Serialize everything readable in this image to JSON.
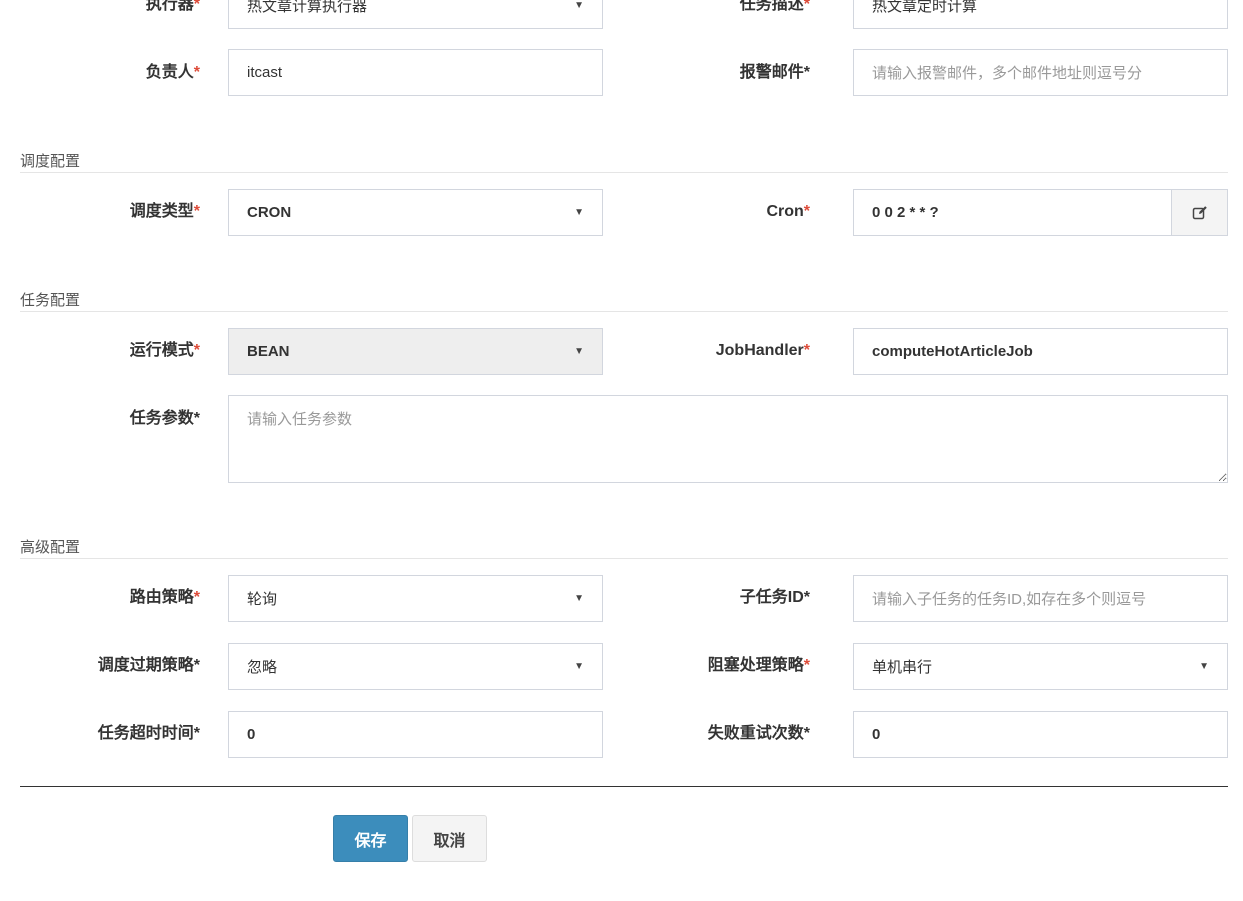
{
  "basic": {
    "executor_label": "执行器",
    "executor_value": "热文章计算执行器",
    "desc_label": "任务描述",
    "desc_value": "热文章定时计算",
    "author_label": "负责人",
    "author_value": "itcast",
    "alarm_label": "报警邮件",
    "alarm_placeholder": "请输入报警邮件，多个邮件地址则逗号分"
  },
  "schedule": {
    "section_title": "调度配置",
    "type_label": "调度类型",
    "type_value": "CRON",
    "cron_label": "Cron",
    "cron_value": "0 0 2 * * ?"
  },
  "task": {
    "section_title": "任务配置",
    "glue_label": "运行模式",
    "glue_value": "BEAN",
    "handler_label": "JobHandler",
    "handler_value": "computeHotArticleJob",
    "param_label": "任务参数",
    "param_placeholder": "请输入任务参数"
  },
  "advanced": {
    "section_title": "高级配置",
    "route_label": "路由策略",
    "route_value": "轮询",
    "child_label": "子任务ID",
    "child_placeholder": "请输入子任务的任务ID,如存在多个则逗号",
    "misfire_label": "调度过期策略",
    "misfire_value": "忽略",
    "block_label": "阻塞处理策略",
    "block_value": "单机串行",
    "timeout_label": "任务超时时间",
    "timeout_value": "0",
    "retry_label": "失败重试次数",
    "retry_value": "0"
  },
  "actions": {
    "save_label": "保存",
    "cancel_label": "取消"
  },
  "required_mark": "*",
  "colors": {
    "required_red": "#dd4b39",
    "primary_button": "#3c8dbc",
    "input_border": "#d2d6de",
    "disabled_bg": "#eeeeee"
  },
  "icons": {
    "dropdown": "caret-down-icon",
    "cron_editor": "edit-icon"
  }
}
